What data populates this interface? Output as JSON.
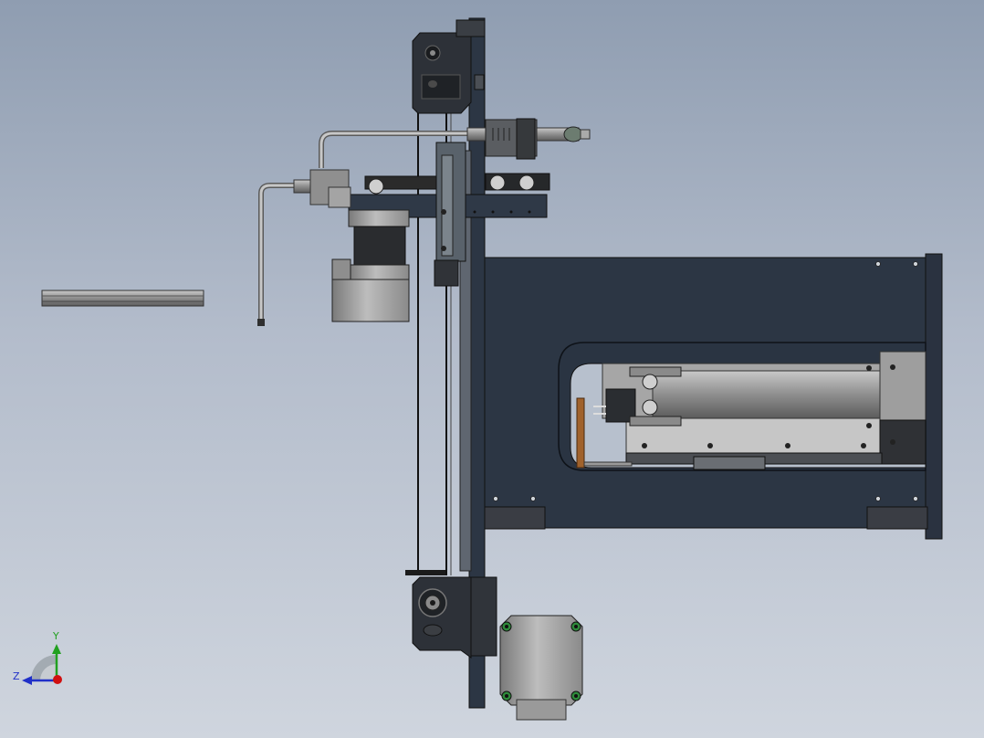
{
  "viewport": {
    "background_top": "#8f9db1",
    "background_bottom": "#cfd5de"
  },
  "model": {
    "frame_color": "#2c3644",
    "steel_color": "#9a9a9a",
    "dark_steel_color": "#3e4245",
    "copper_color": "#a0622c",
    "mount_accent_color": "#2e8a3a"
  },
  "triad": {
    "y_label": "Y",
    "z_label": "Z",
    "y_color": "#22a020",
    "z_color": "#2030c8",
    "x_color": "#d01010",
    "icon": "coordinate-triad-icon"
  }
}
